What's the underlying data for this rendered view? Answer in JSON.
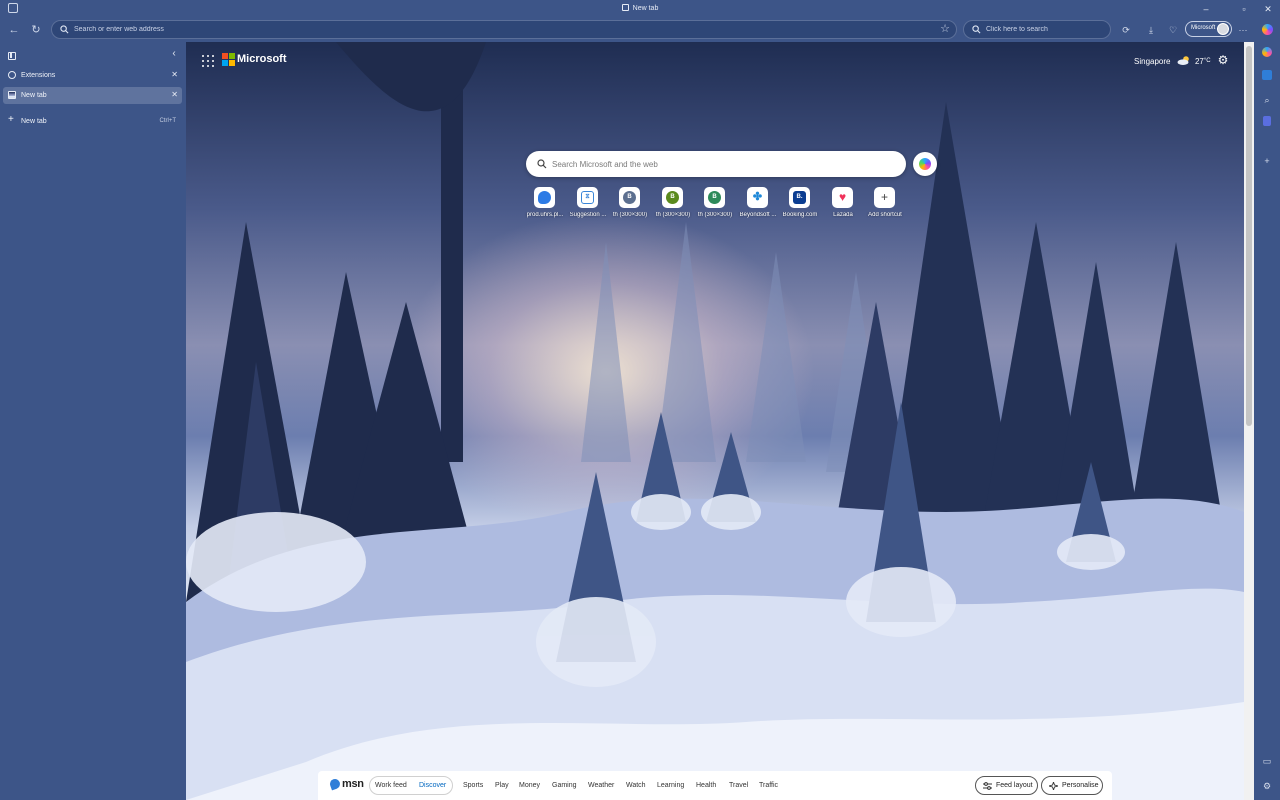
{
  "window": {
    "title": "New tab"
  },
  "toolbar": {
    "address_placeholder": "Search or enter web address",
    "search_placeholder": "Click here to search",
    "profile_label": "Microsoft"
  },
  "tabs_pane": {
    "tabs": [
      {
        "label": "Extensions"
      },
      {
        "label": "New tab"
      }
    ],
    "new_tab_label": "New tab",
    "new_tab_shortcut": "Ctrl+T"
  },
  "newtab": {
    "brand": "Microsoft",
    "weather": {
      "location": "Singapore",
      "temperature": "27",
      "unit": "°C"
    },
    "search_placeholder": "Search Microsoft and the web",
    "shortcuts": [
      {
        "label": "prod.uhrs.pl...",
        "letter": "",
        "color": "#2d7be5"
      },
      {
        "label": "Suggestion ...",
        "letter": "",
        "color": "#3b86d8"
      },
      {
        "label": "th (300×300)",
        "letter": "B",
        "color": "#5c6f8f"
      },
      {
        "label": "th (300×300)",
        "letter": "B",
        "color": "#5b8a1e"
      },
      {
        "label": "th (300×300)",
        "letter": "B",
        "color": "#2e8a5a"
      },
      {
        "label": "Beyondsoft ...",
        "letter": "",
        "color": "#1e88d8"
      },
      {
        "label": "Booking.com",
        "letter": "B.",
        "color": "#0b3d91"
      },
      {
        "label": "Lazada",
        "letter": "",
        "color": "#f0325a"
      },
      {
        "label": "Add shortcut",
        "letter": "+",
        "color": "#ffffff"
      }
    ]
  },
  "msn": {
    "logo": "msn",
    "feed_tabs": [
      "Work feed",
      "Discover"
    ],
    "active_feed": "Discover",
    "nav": [
      "Sports",
      "Play",
      "Money",
      "Gaming",
      "Weather",
      "Watch",
      "Learning",
      "Health",
      "Travel",
      "Traffic"
    ],
    "feed_layout_label": "Feed layout",
    "personalise_label": "Personalise"
  },
  "colors": {
    "chrome": "#3d5588",
    "accent": "#0067c0"
  }
}
